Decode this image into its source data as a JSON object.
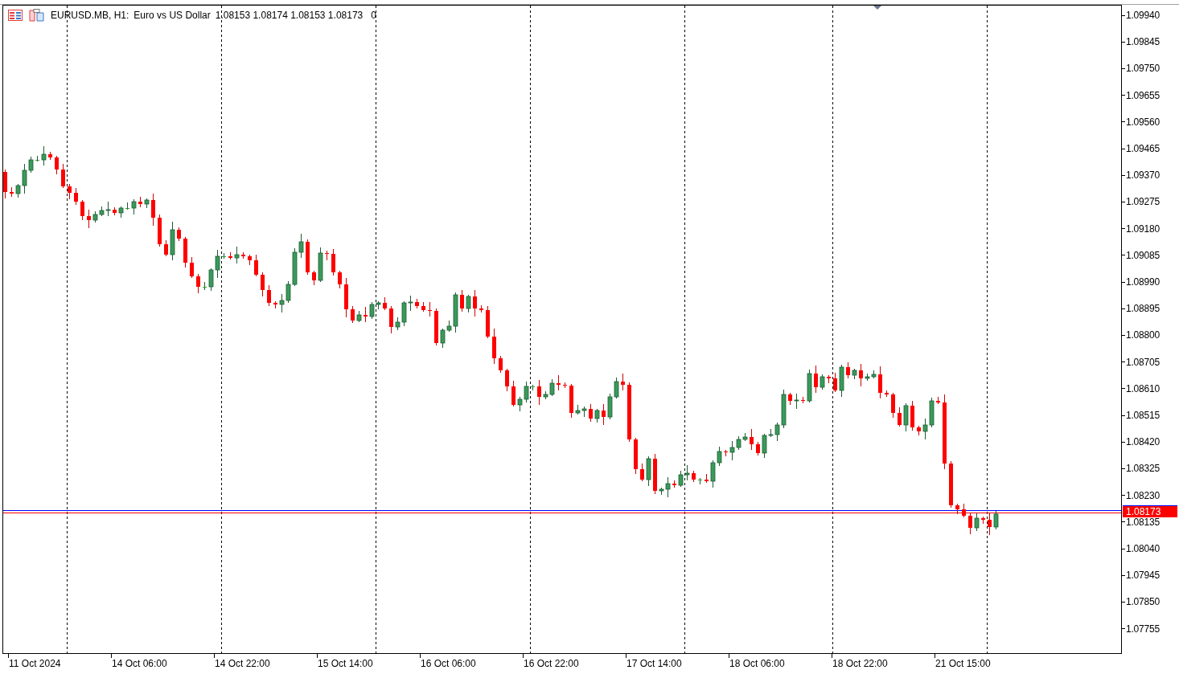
{
  "chart": {
    "symbol_title": "EURUSD.MB, H1:",
    "description": "Euro vs US Dollar",
    "ohlc": "1.08153 1.08174 1.08153 1.08173",
    "tick_volume": "0"
  },
  "price_axis": {
    "ticks": [
      "1.09940",
      "1.09845",
      "1.09750",
      "1.09655",
      "1.09560",
      "1.09465",
      "1.09370",
      "1.09275",
      "1.09180",
      "1.09085",
      "1.08990",
      "1.08895",
      "1.08800",
      "1.08705",
      "1.08610",
      "1.08515",
      "1.08420",
      "1.08325",
      "1.08230",
      "1.08135",
      "1.08040",
      "1.07945",
      "1.07850",
      "1.07755"
    ],
    "current_price": "1.08173"
  },
  "time_axis": {
    "labels": [
      "11 Oct 2024",
      "14 Oct 06:00",
      "14 Oct 22:00",
      "15 Oct 14:00",
      "16 Oct 06:00",
      "16 Oct 22:00",
      "17 Oct 14:00",
      "18 Oct 06:00",
      "18 Oct 22:00",
      "21 Oct 15:00"
    ]
  }
}
